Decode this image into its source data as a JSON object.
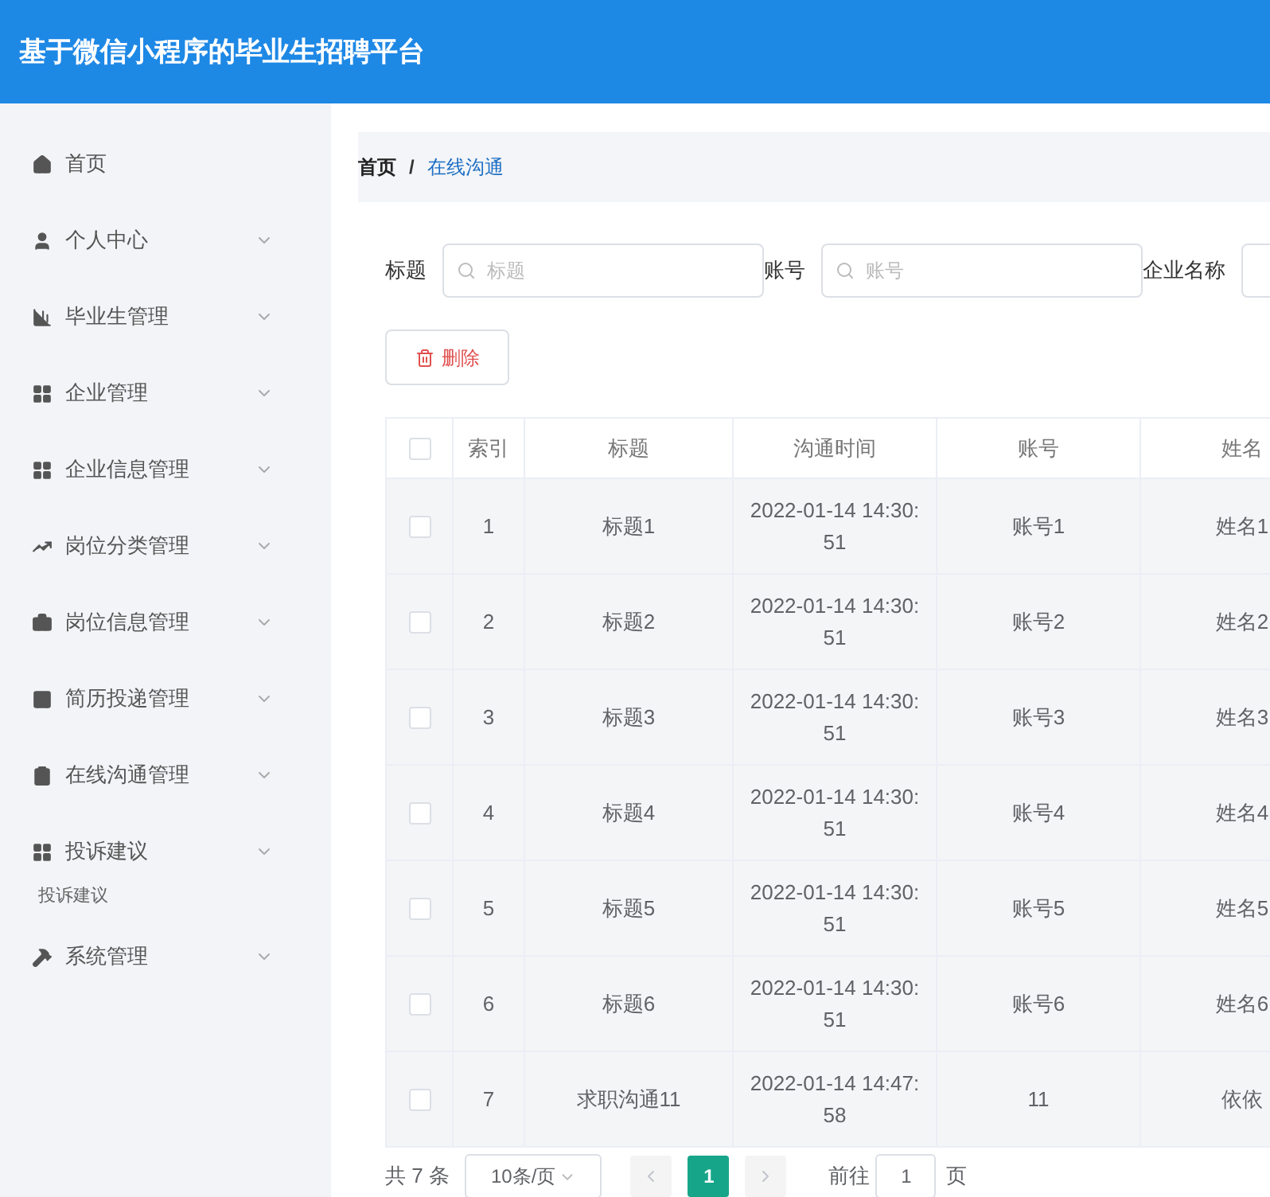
{
  "header": {
    "title": "基于微信小程序的毕业生招聘平台"
  },
  "sidebar": {
    "items": [
      {
        "label": "首页",
        "kind": "link"
      },
      {
        "label": "个人中心",
        "kind": "group"
      },
      {
        "label": "毕业生管理",
        "kind": "group"
      },
      {
        "label": "企业管理",
        "kind": "group"
      },
      {
        "label": "企业信息管理",
        "kind": "group"
      },
      {
        "label": "岗位分类管理",
        "kind": "group"
      },
      {
        "label": "岗位信息管理",
        "kind": "group"
      },
      {
        "label": "简历投递管理",
        "kind": "group"
      },
      {
        "label": "在线沟通管理",
        "kind": "group"
      },
      {
        "label": "投诉建议",
        "kind": "group",
        "children": [
          {
            "label": "投诉建议"
          }
        ]
      },
      {
        "label": "系统管理",
        "kind": "group"
      }
    ]
  },
  "breadcrumb_separator": "/",
  "breadcrumb": [
    {
      "label": "首页",
      "selected": false
    },
    {
      "label": "在线沟通",
      "selected": true
    }
  ],
  "filters": [
    {
      "label": "标题",
      "placeholder": "标题"
    },
    {
      "label": "账号",
      "placeholder": "账号"
    },
    {
      "label": "企业名称"
    }
  ],
  "delete_button": "删除",
  "table": {
    "header_checked": false,
    "columns": [
      "索引",
      "标题",
      "沟通时间",
      "账号",
      "姓名"
    ],
    "rows": [
      {
        "checked": false,
        "cells": [
          "1",
          "标题1",
          "2022-01-14 14:30:51",
          "账号1",
          "姓名1"
        ]
      },
      {
        "checked": false,
        "cells": [
          "2",
          "标题2",
          "2022-01-14 14:30:51",
          "账号2",
          "姓名2"
        ]
      },
      {
        "checked": false,
        "cells": [
          "3",
          "标题3",
          "2022-01-14 14:30:51",
          "账号3",
          "姓名3"
        ]
      },
      {
        "checked": false,
        "cells": [
          "4",
          "标题4",
          "2022-01-14 14:30:51",
          "账号4",
          "姓名4"
        ]
      },
      {
        "checked": false,
        "cells": [
          "5",
          "标题5",
          "2022-01-14 14:30:51",
          "账号5",
          "姓名5"
        ]
      },
      {
        "checked": false,
        "cells": [
          "6",
          "标题6",
          "2022-01-14 14:30:51",
          "账号6",
          "姓名6"
        ]
      },
      {
        "checked": false,
        "cells": [
          "7",
          "求职沟通11",
          "2022-01-14 14:47:58",
          "11",
          "依依"
        ]
      }
    ]
  },
  "pagination": {
    "total": "共 7 条",
    "page_size": "10条/页",
    "pages": [
      {
        "label": "1",
        "selected": true
      }
    ],
    "goto_label": "前往",
    "goto_value": "1",
    "goto_suffix": "页"
  }
}
